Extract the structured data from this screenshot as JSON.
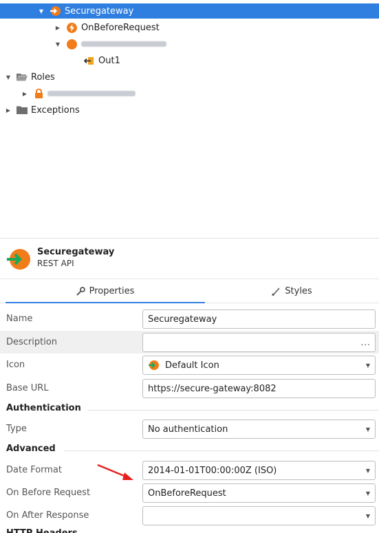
{
  "tree": {
    "items": [
      {
        "label": "Securegateway",
        "icon": "rest-api-icon",
        "expanded": true,
        "selected": true
      },
      {
        "label": "OnBeforeRequest",
        "icon": "bolt-action-icon"
      },
      {
        "label": "",
        "icon": "orange-circle-icon",
        "blurred": true
      },
      {
        "label": "Out1",
        "icon": "output-param-icon"
      },
      {
        "label": "Roles",
        "icon": "folder-open-icon"
      },
      {
        "label": "",
        "icon": "lock-icon",
        "blurred": true
      },
      {
        "label": "Exceptions",
        "icon": "folder-icon"
      }
    ]
  },
  "header": {
    "title": "Securegateway",
    "subtitle": "REST API"
  },
  "tabs": {
    "properties": "Properties",
    "styles": "Styles"
  },
  "properties": {
    "name": {
      "label": "Name",
      "value": "Securegateway"
    },
    "description": {
      "label": "Description",
      "value": "",
      "dots": "..."
    },
    "icon": {
      "label": "Icon",
      "value": "Default Icon"
    },
    "base_url": {
      "label": "Base URL",
      "value": "https://secure-gateway:8082"
    },
    "authentication_section": "Authentication",
    "type": {
      "label": "Type",
      "value": "No authentication"
    },
    "advanced_section": "Advanced",
    "date_format": {
      "label": "Date Format",
      "value": "2014-01-01T00:00:00Z (ISO)"
    },
    "on_before_request": {
      "label": "On Before Request",
      "value": "OnBeforeRequest"
    },
    "on_after_response": {
      "label": "On After Response",
      "value": ""
    },
    "http_headers_section": "HTTP Headers"
  },
  "colors": {
    "selection": "#2f7fe0",
    "accent_orange": "#f07c1a",
    "accent_green": "#1aa85c",
    "annotation_red": "#e3211c"
  }
}
